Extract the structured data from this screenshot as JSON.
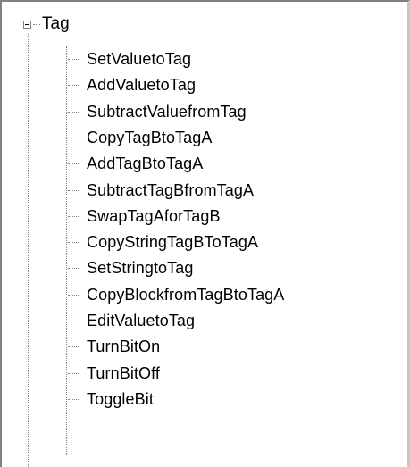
{
  "tree": {
    "root": {
      "label": "Tag",
      "expanded": true
    },
    "children": [
      "SetValuetoTag",
      "AddValuetoTag",
      "SubtractValuefromTag",
      "CopyTagBtoTagA",
      "AddTagBtoTagA",
      "SubtractTagBfromTagA",
      "SwapTagAforTagB",
      "CopyStringTagBToTagA",
      "SetStringtoTag",
      "CopyBlockfromTagBtoTagA",
      "EditValuetoTag",
      "TurnBitOn",
      "TurnBitOff",
      "ToggleBit"
    ]
  },
  "colors": {
    "background": "#ffffff",
    "text": "#000000",
    "tree_lines": "#808080"
  }
}
